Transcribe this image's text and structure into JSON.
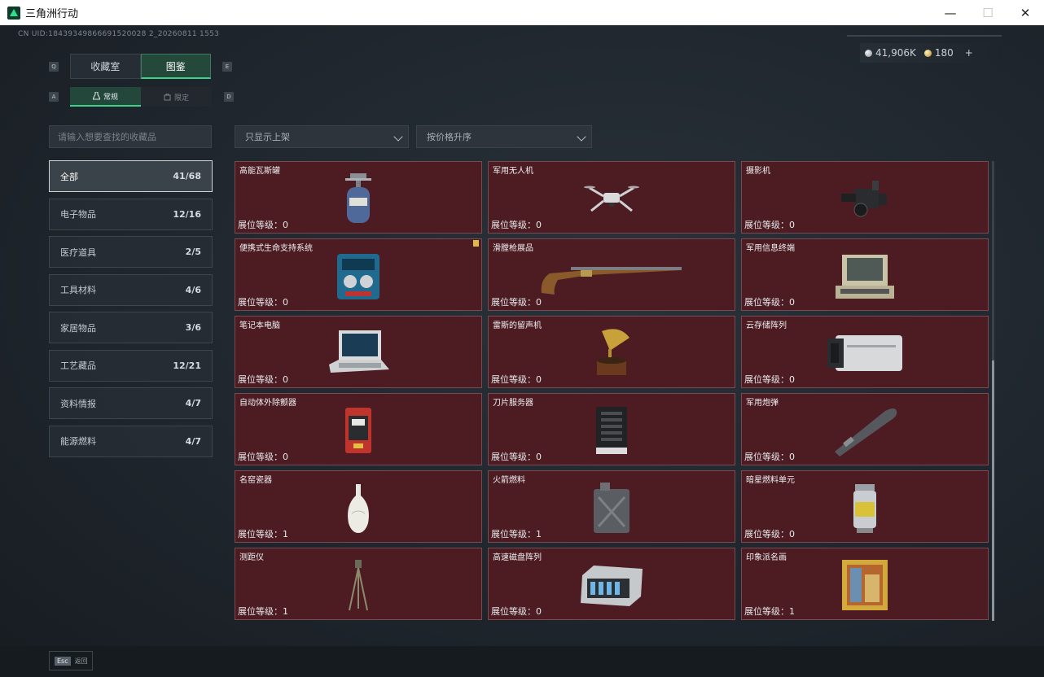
{
  "window": {
    "title": "三角洲行动",
    "minimize": "—",
    "maximize": "☐",
    "close": "✕"
  },
  "uid_text": "CN UID:18439349866691520028 2_20260811 1553",
  "currency": {
    "silver": "41,906K",
    "gold": "180",
    "plus": "+"
  },
  "keyhints": {
    "q": "Q",
    "e": "E",
    "a": "A",
    "d": "D"
  },
  "main_tabs": [
    {
      "label": "收藏室"
    },
    {
      "label": "图鉴"
    }
  ],
  "sub_tabs": [
    {
      "label": "常规"
    },
    {
      "label": "限定"
    }
  ],
  "search": {
    "placeholder": "请输入想要查找的收藏品"
  },
  "filters": {
    "shelf": "只显示上架",
    "sort": "按价格升序"
  },
  "categories": [
    {
      "label": "全部",
      "count": "41/68"
    },
    {
      "label": "电子物品",
      "count": "12/16"
    },
    {
      "label": "医疗道具",
      "count": "2/5"
    },
    {
      "label": "工具材料",
      "count": "4/6"
    },
    {
      "label": "家居物品",
      "count": "3/6"
    },
    {
      "label": "工艺藏品",
      "count": "12/21"
    },
    {
      "label": "资料情报",
      "count": "4/7"
    },
    {
      "label": "能源燃料",
      "count": "4/7"
    }
  ],
  "items": [
    {
      "name": "高能瓦斯罐",
      "level": "展位等级：0",
      "icon": "gas-canister-icon"
    },
    {
      "name": "军用无人机",
      "level": "展位等级：0",
      "icon": "drone-icon"
    },
    {
      "name": "摄影机",
      "level": "展位等级：0",
      "icon": "camera-icon"
    },
    {
      "name": "便携式生命支持系统",
      "level": "展位等级：0",
      "icon": "life-support-icon"
    },
    {
      "name": "滑膛枪展品",
      "level": "展位等级：0",
      "icon": "musket-icon"
    },
    {
      "name": "军用信息终端",
      "level": "展位等级：0",
      "icon": "terminal-icon"
    },
    {
      "name": "笔记本电脑",
      "level": "展位等级：0",
      "icon": "laptop-icon"
    },
    {
      "name": "雷斯的留声机",
      "level": "展位等级：0",
      "icon": "gramophone-icon"
    },
    {
      "name": "云存储阵列",
      "level": "展位等级：0",
      "icon": "storage-array-icon"
    },
    {
      "name": "自动体外除颤器",
      "level": "展位等级：0",
      "icon": "defibrillator-icon"
    },
    {
      "name": "刀片服务器",
      "level": "展位等级：0",
      "icon": "server-icon"
    },
    {
      "name": "军用炮弹",
      "level": "展位等级：0",
      "icon": "shell-icon"
    },
    {
      "name": "名窑瓷器",
      "level": "展位等级：1",
      "icon": "vase-icon"
    },
    {
      "name": "火箭燃料",
      "level": "展位等级：1",
      "icon": "fuel-can-icon"
    },
    {
      "name": "暗星燃料单元",
      "level": "展位等级：0",
      "icon": "fuel-cell-icon"
    },
    {
      "name": "测距仪",
      "level": "展位等级：1",
      "icon": "rangefinder-icon"
    },
    {
      "name": "高速磁盘阵列",
      "level": "展位等级：0",
      "icon": "disk-array-icon"
    },
    {
      "name": "印象派名画",
      "level": "展位等级：1",
      "icon": "painting-icon"
    }
  ],
  "footer": {
    "esc_key": "Esc",
    "back_label": "返回"
  },
  "colors": {
    "accent": "#3fd08a",
    "card_bg": "#4d1c23",
    "card_border": "#7a4a52",
    "badge": "#e0b84a"
  }
}
